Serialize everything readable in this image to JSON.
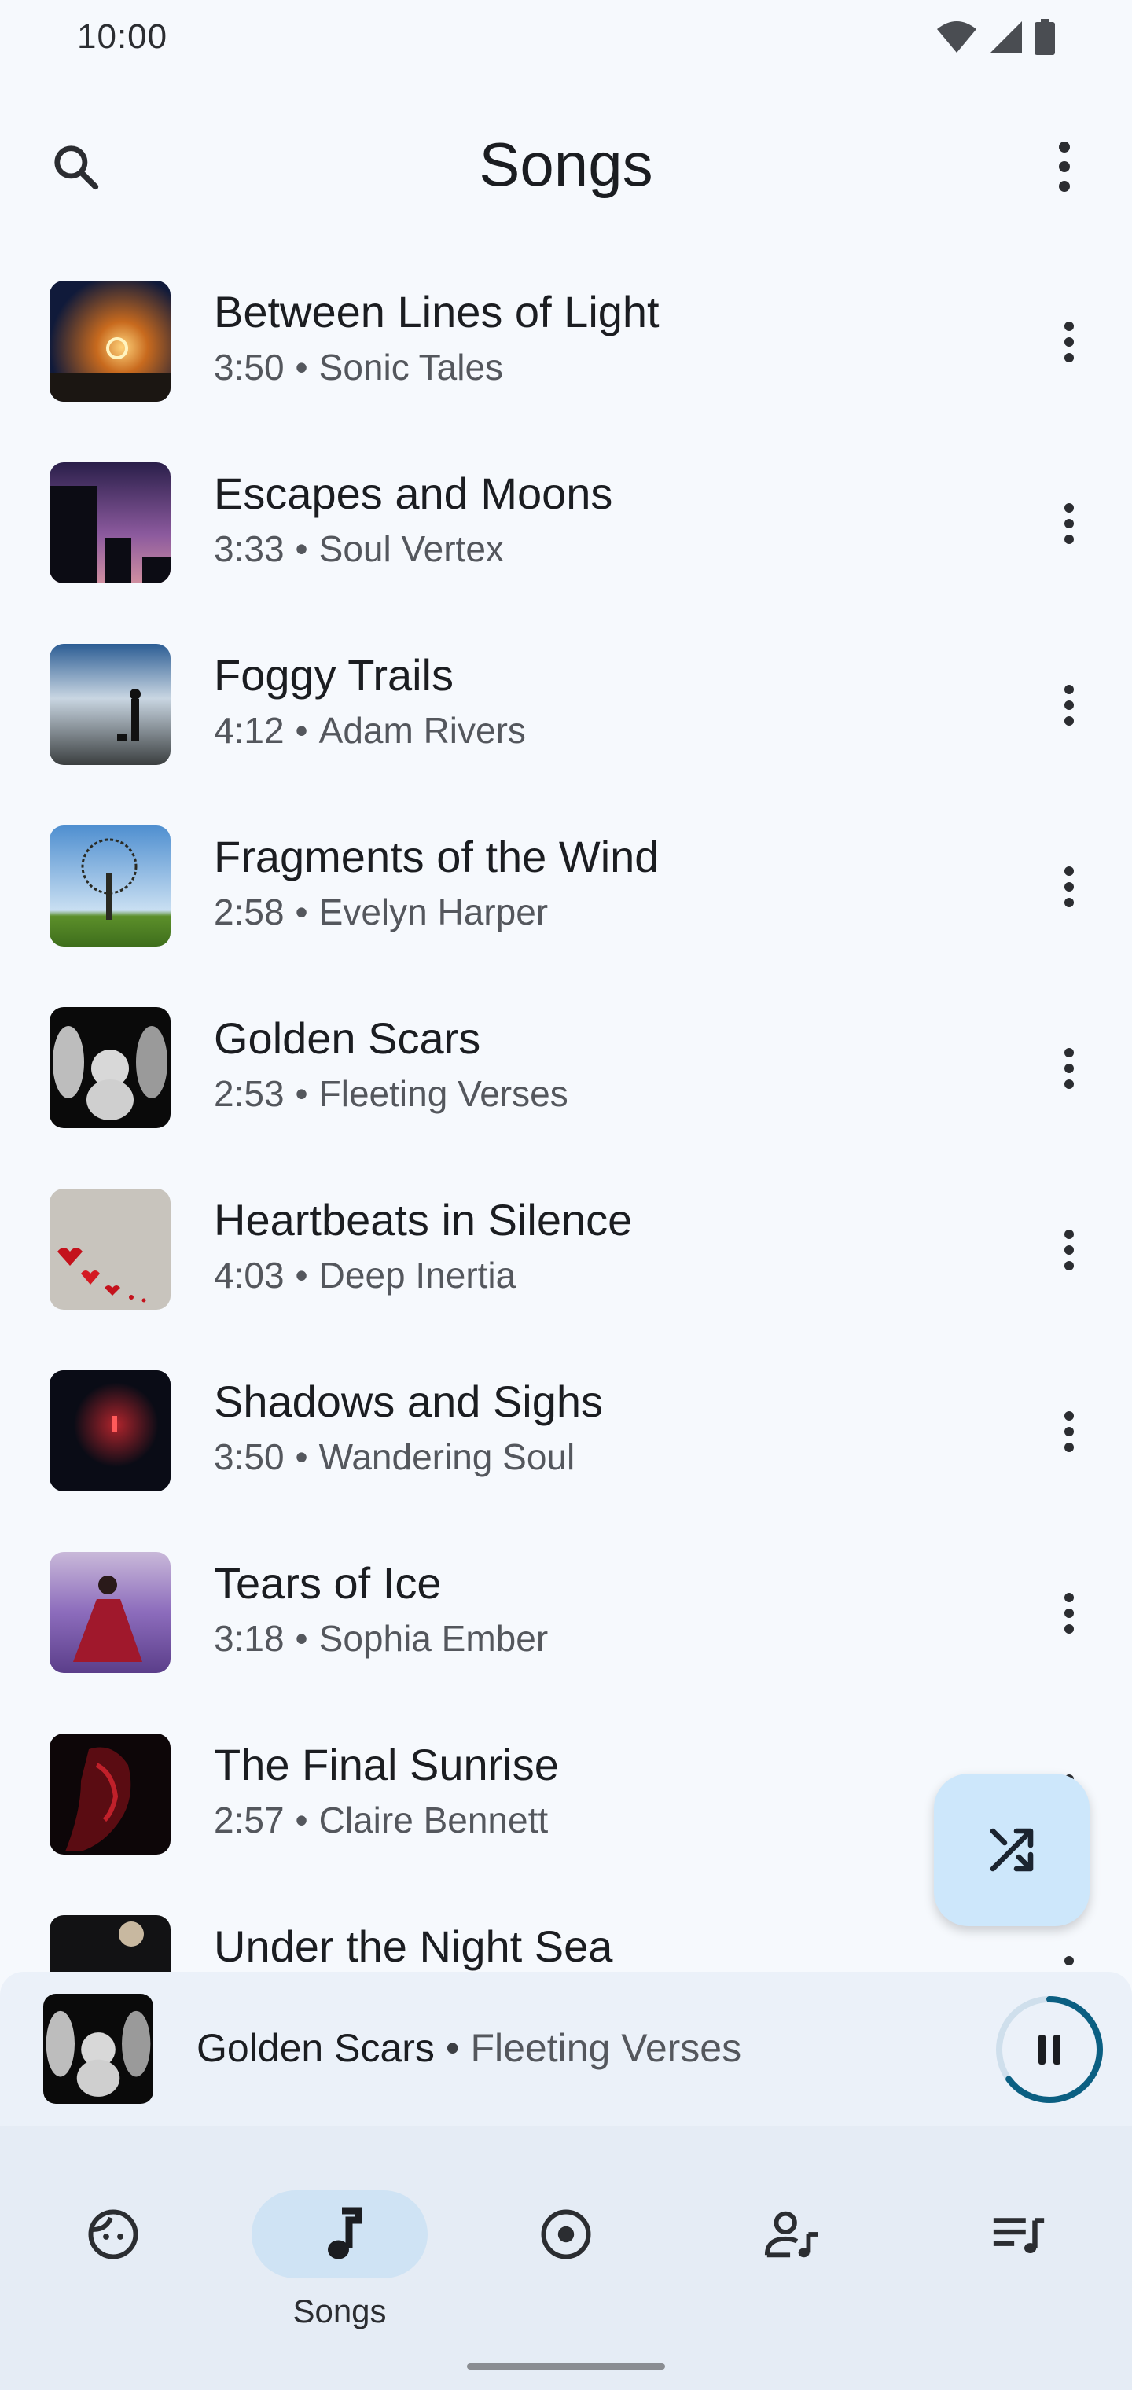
{
  "status_bar": {
    "time": "10:00"
  },
  "header": {
    "title": "Songs"
  },
  "songs": [
    {
      "title": "Between Lines of Light",
      "duration": "3:50",
      "sep": "•",
      "artist": "Sonic Tales"
    },
    {
      "title": "Escapes and Moons",
      "duration": "3:33",
      "sep": "•",
      "artist": "Soul Vertex"
    },
    {
      "title": "Foggy Trails",
      "duration": "4:12",
      "sep": "•",
      "artist": "Adam Rivers"
    },
    {
      "title": "Fragments of the Wind",
      "duration": "2:58",
      "sep": "•",
      "artist": "Evelyn Harper"
    },
    {
      "title": "Golden Scars",
      "duration": "2:53",
      "sep": "•",
      "artist": "Fleeting Verses"
    },
    {
      "title": "Heartbeats in Silence",
      "duration": "4:03",
      "sep": "•",
      "artist": "Deep Inertia"
    },
    {
      "title": "Shadows and Sighs",
      "duration": "3:50",
      "sep": "•",
      "artist": "Wandering Soul"
    },
    {
      "title": "Tears of Ice",
      "duration": "3:18",
      "sep": "•",
      "artist": "Sophia Ember"
    },
    {
      "title": "The Final Sunrise",
      "duration": "2:57",
      "sep": "•",
      "artist": "Claire Bennett"
    },
    {
      "title": "Under the Night Sea",
      "duration": "",
      "sep": "",
      "artist": ""
    }
  ],
  "now_playing": {
    "title": "Golden Scars",
    "sep": "•",
    "artist": "Fleeting Verses",
    "progress": 0.65
  },
  "nav": {
    "active_label": "Songs"
  },
  "colors": {
    "accent": "#0b5f82",
    "fab": "#cde7fb",
    "nav_pill": "#cfe3f4"
  }
}
